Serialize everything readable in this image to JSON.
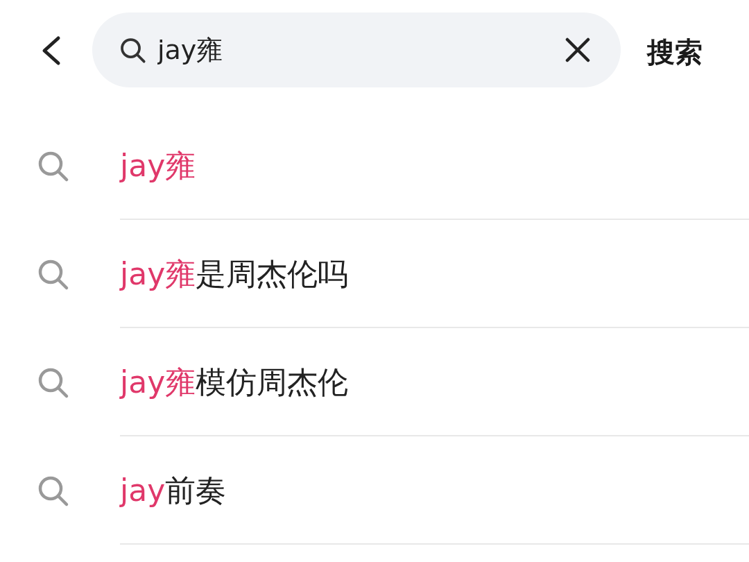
{
  "search": {
    "value": "jay雍",
    "action": "搜索"
  },
  "suggestions": [
    {
      "match": "jay雍"
    },
    {
      "match": "jay雍",
      "rest": "是周杰伦吗"
    },
    {
      "match": "jay雍",
      "rest": "模仿周杰伦"
    },
    {
      "match": "jay",
      "rest": "前奏"
    }
  ]
}
